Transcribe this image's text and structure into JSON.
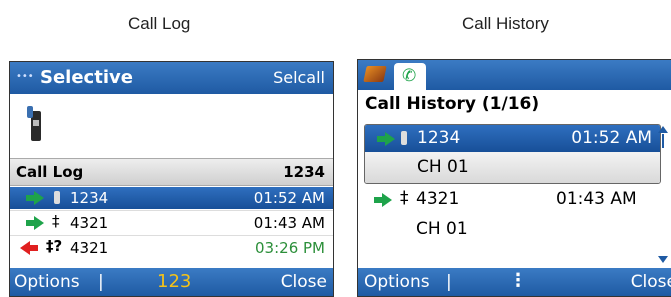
{
  "captions": {
    "left": "Call Log",
    "right": "Call History"
  },
  "left_screen": {
    "title": "Selective",
    "title_right": "Selcall",
    "section_label": "Call Log",
    "section_value": "1234",
    "rows": [
      {
        "number": "1234",
        "time": "01:52 AM"
      },
      {
        "number": "4321",
        "time": "01:43 AM"
      },
      {
        "number": "4321",
        "time": "03:26 PM"
      }
    ],
    "softkeys": {
      "left": "Options",
      "center": "123",
      "right": "Close"
    }
  },
  "right_screen": {
    "header": "Call History (1/16)",
    "entries": [
      {
        "number": "1234",
        "time": "01:52 AM",
        "channel": "CH 01"
      },
      {
        "number": "4321",
        "time": "01:43 AM",
        "channel": "CH 01"
      }
    ],
    "softkeys": {
      "left": "Options",
      "right": "Close"
    }
  },
  "colors": {
    "accent": "#1f5aa3",
    "green": "#1ea34a",
    "red": "#e02020"
  }
}
